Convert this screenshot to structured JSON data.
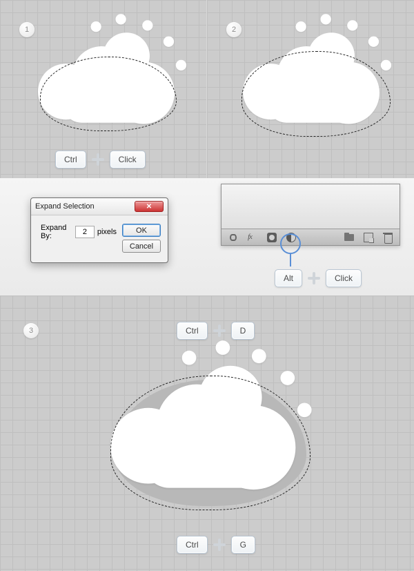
{
  "steps": {
    "s1": "1",
    "s2": "2",
    "s3": "3"
  },
  "keys": {
    "ctrl": "Ctrl",
    "click": "Click",
    "alt": "Alt",
    "d": "D",
    "g": "G"
  },
  "dialog": {
    "title": "Expand Selection",
    "expand_by_label": "Expand By:",
    "expand_value": "2",
    "units": "pixels",
    "ok": "OK",
    "cancel": "Cancel"
  },
  "ps_panel": {
    "fx_label": "fx"
  }
}
